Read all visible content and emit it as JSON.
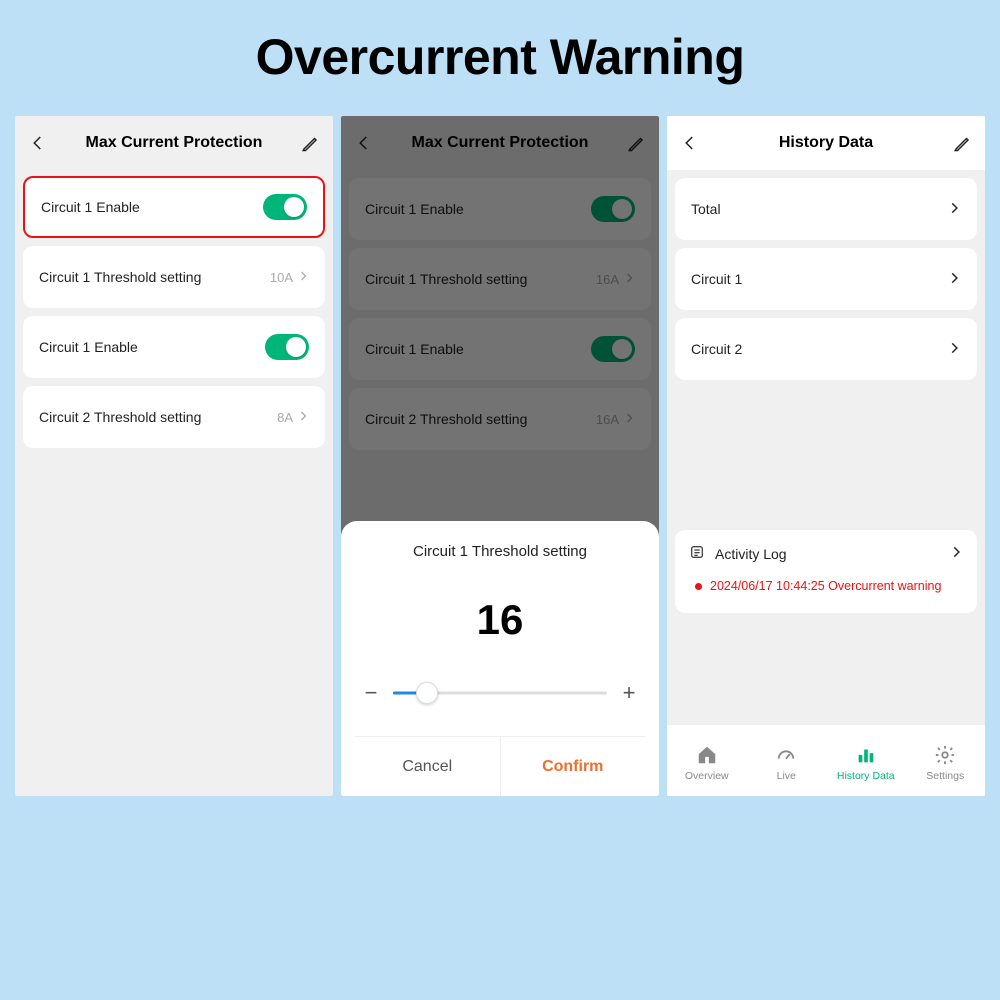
{
  "page_title": "Overcurrent Warning",
  "colors": {
    "accent": "#00b578",
    "warning": "#e11",
    "confirm": "#ee6f2d"
  },
  "phone1": {
    "header_title": "Max Current Protection",
    "rows": [
      {
        "label": "Circuit 1 Enable",
        "type": "toggle",
        "on": true,
        "highlighted": true
      },
      {
        "label": "Circuit 1 Threshold setting",
        "type": "value",
        "value": "10A"
      },
      {
        "label": "Circuit 1 Enable",
        "type": "toggle",
        "on": true
      },
      {
        "label": "Circuit 2 Threshold setting",
        "type": "value",
        "value": "8A"
      }
    ]
  },
  "phone2": {
    "header_title": "Max Current Protection",
    "rows": [
      {
        "label": "Circuit 1 Enable",
        "type": "toggle",
        "on": true
      },
      {
        "label": "Circuit 1 Threshold setting",
        "type": "value",
        "value": "16A"
      },
      {
        "label": "Circuit 1 Enable",
        "type": "toggle",
        "on": true
      },
      {
        "label": "Circuit 2 Threshold setting",
        "type": "value",
        "value": "16A"
      }
    ],
    "sheet": {
      "title": "Circuit 1 Threshold setting",
      "value": "16",
      "slider_percent": 16,
      "cancel": "Cancel",
      "confirm": "Confirm"
    }
  },
  "phone3": {
    "header_title": "History Data",
    "rows": [
      {
        "label": "Total"
      },
      {
        "label": "Circuit 1"
      },
      {
        "label": "Circuit 2"
      }
    ],
    "activity_title": "Activity Log",
    "log_entry": "2024/06/17 10:44:25 Overcurrent warning",
    "tabs": [
      {
        "label": "Overview",
        "icon": "home"
      },
      {
        "label": "Live",
        "icon": "gauge"
      },
      {
        "label": "History Data",
        "icon": "bar",
        "active": true
      },
      {
        "label": "Settings",
        "icon": "gear"
      }
    ]
  }
}
